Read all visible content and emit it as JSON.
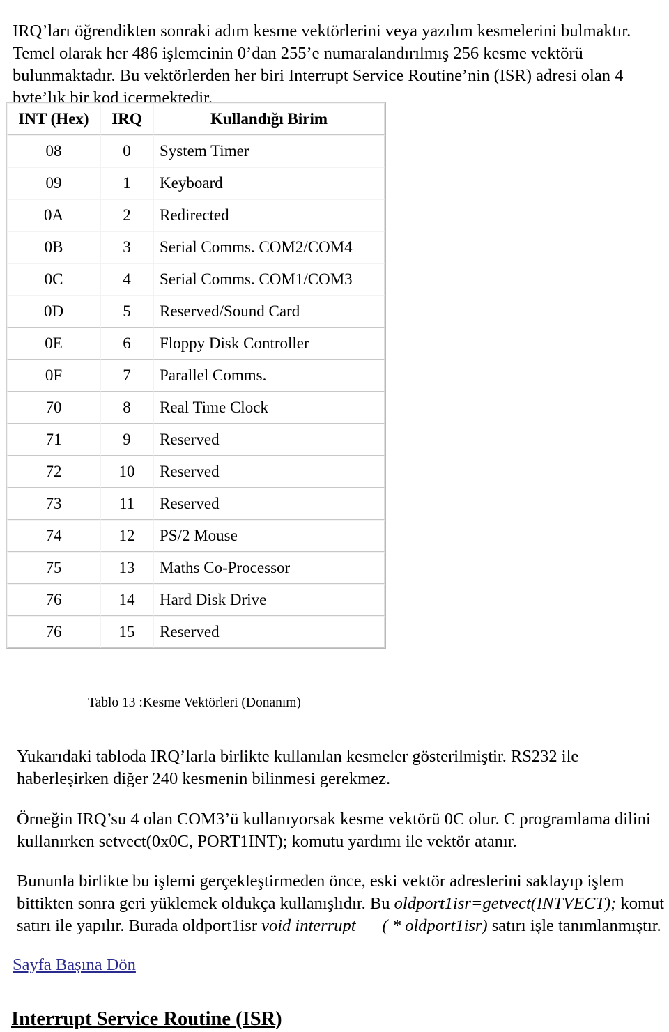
{
  "intro_paragraph": "IRQ’ları öğrendikten sonraki adım kesme vektörlerini veya yazılım kesmelerini bulmaktır. Temel olarak her 486 işlemcinin 0’dan 255’e numaralandırılmış 256 kesme vektörü bulunmaktadır. Bu vektörlerden her biri Interrupt Service Routine’nin (ISR) adresi olan 4 byte’lık bir kod içermektedir.",
  "table": {
    "headers": {
      "int_hex": "INT (Hex)",
      "irq": "IRQ",
      "unit": "Kullandığı Birim"
    },
    "rows": [
      {
        "int_hex": "08",
        "irq": "0",
        "unit": "System Timer"
      },
      {
        "int_hex": "09",
        "irq": "1",
        "unit": "Keyboard"
      },
      {
        "int_hex": "0A",
        "irq": "2",
        "unit": "Redirected"
      },
      {
        "int_hex": "0B",
        "irq": "3",
        "unit": "Serial Comms. COM2/COM4"
      },
      {
        "int_hex": "0C",
        "irq": "4",
        "unit": "Serial Comms. COM1/COM3"
      },
      {
        "int_hex": "0D",
        "irq": "5",
        "unit": "Reserved/Sound Card"
      },
      {
        "int_hex": "0E",
        "irq": "6",
        "unit": "Floppy Disk Controller"
      },
      {
        "int_hex": "0F",
        "irq": "7",
        "unit": "Parallel Comms."
      },
      {
        "int_hex": "70",
        "irq": "8",
        "unit": "Real Time Clock"
      },
      {
        "int_hex": "71",
        "irq": "9",
        "unit": "Reserved"
      },
      {
        "int_hex": "72",
        "irq": "10",
        "unit": "Reserved"
      },
      {
        "int_hex": "73",
        "irq": "11",
        "unit": "Reserved"
      },
      {
        "int_hex": "74",
        "irq": "12",
        "unit": "PS/2 Mouse"
      },
      {
        "int_hex": "75",
        "irq": "13",
        "unit": "Maths Co-Processor"
      },
      {
        "int_hex": "76",
        "irq": "14",
        "unit": "Hard Disk Drive"
      },
      {
        "int_hex": "76",
        "irq": "15",
        "unit": "Reserved"
      }
    ],
    "caption": "Tablo 13 :Kesme Vektörleri  (Donanım)"
  },
  "paragraphs": {
    "p1": "Yukarıdaki tabloda IRQ’larla birlikte kullanılan kesmeler gösterilmiştir. RS232 ile haberleşirken diğer 240 kesmenin bilinmesi gerekmez.",
    "p2": "Örneğin IRQ’su 4 olan COM3’ü kullanıyorsak kesme vektörü 0C olur. C programlama dilini kullanırken setvect(0x0C, PORT1INT); komutu yardımı ile vektör atanır.",
    "p3": {
      "part1": "Bununla birlikte bu işlemi gerçekleştirmeden önce, eski vektör adreslerini saklayıp işlem bittikten sonra geri yüklemek oldukça kullanışlıdır. Bu ",
      "italic1": "oldport1isr=getvect(INTVECT);",
      "part2": " komut satırı ile yapılır. Burada oldport1isr ",
      "italic2": "void interrupt",
      "italic3": "( * oldport1isr)",
      "part3": " satırı işle tanımlanmıştır."
    }
  },
  "links": {
    "back_to_top": "Sayfa Başına Dön"
  },
  "section_heading": "Interrupt Service Routine (ISR)",
  "colors": {
    "link": "#2b2b8f",
    "text": "#000000",
    "table_border": "#c8c8c8",
    "background": "#ffffff"
  }
}
